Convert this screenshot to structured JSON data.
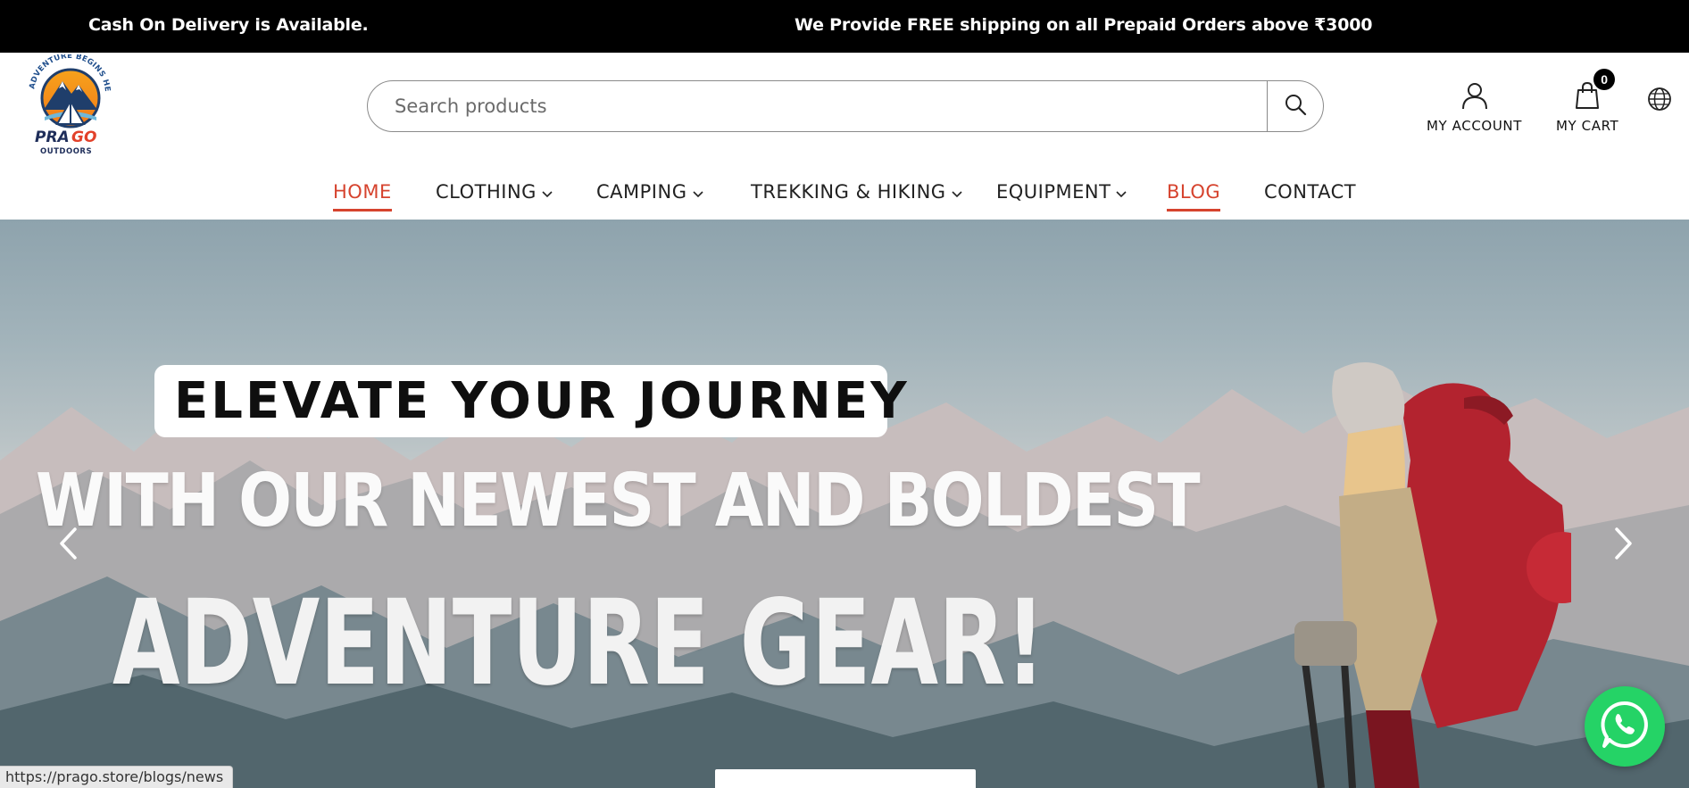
{
  "announcement": {
    "left": "Cash On Delivery is Available.",
    "right": "We Provide FREE shipping on all Prepaid Orders above ₹3000"
  },
  "logo": {
    "arc_text": "ADVENTURE BEGINS HERE",
    "brand_top": "PRAGO",
    "brand_bottom": "OUTDOORS"
  },
  "search": {
    "placeholder": "Search products",
    "value": ""
  },
  "header_actions": {
    "account_label": "MY ACCOUNT",
    "cart_label": "MY CART",
    "cart_count": "0"
  },
  "nav": {
    "items": [
      {
        "label": "HOME",
        "active": true,
        "dropdown": false
      },
      {
        "label": "CLOTHING",
        "active": false,
        "dropdown": true
      },
      {
        "label": "CAMPING",
        "active": false,
        "dropdown": true
      },
      {
        "label": "TREKKING & HIKING",
        "active": false,
        "dropdown": true
      },
      {
        "label": "EQUIPMENT",
        "active": false,
        "dropdown": true
      },
      {
        "label": "BLOG",
        "active": true,
        "dropdown": false
      },
      {
        "label": "CONTACT",
        "active": false,
        "dropdown": false
      }
    ]
  },
  "hero": {
    "line1": "ELEVATE YOUR JOURNEY",
    "line2": "WITH OUR NEWEST AND BOLDEST",
    "line3": "ADVENTURE GEAR!"
  },
  "status_bar": {
    "url": "https://prago.store/blogs/news"
  },
  "colors": {
    "accent": "#d6432e",
    "topbar": "#000000",
    "whatsapp": "#25d366"
  },
  "icons": [
    "search-icon",
    "user-icon",
    "shopping-bag-icon",
    "globe-icon",
    "chevron-left-icon",
    "chevron-right-icon",
    "whatsapp-icon",
    "chevron-down-icon"
  ]
}
